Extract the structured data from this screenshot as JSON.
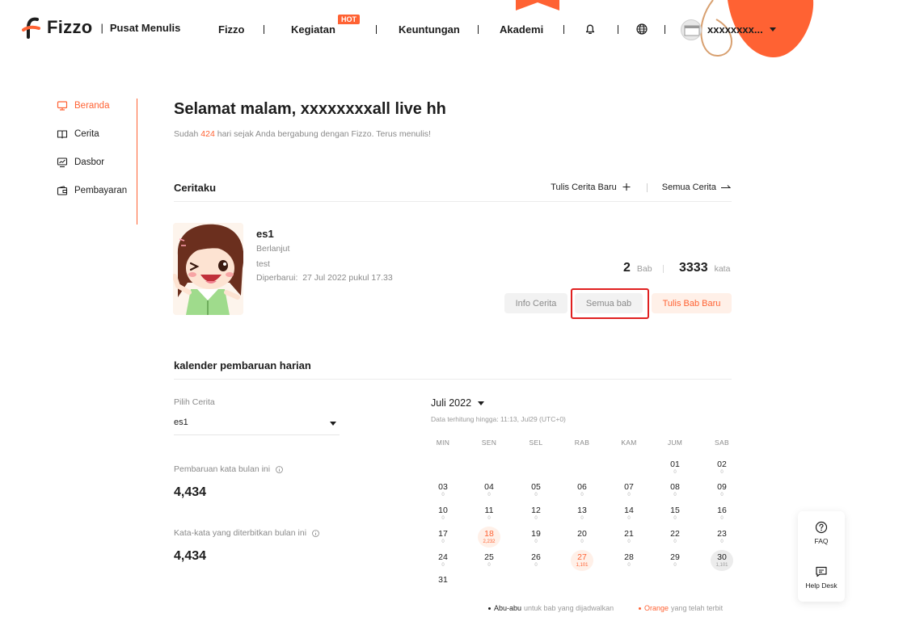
{
  "header": {
    "brand": "Fizzo",
    "sub_brand": "Pusat Menulis",
    "nav": [
      {
        "label": "Fizzo"
      },
      {
        "label": "Kegiatan",
        "badge": "HOT"
      },
      {
        "label": "Keuntungan"
      },
      {
        "label": "Akademi"
      }
    ],
    "username": "xxxxxxxx...",
    "icons": [
      "bell-icon",
      "globe-icon"
    ],
    "accent_color": "#ff6233"
  },
  "sidebar": {
    "items": [
      {
        "label": "Beranda",
        "icon": "monitor-icon",
        "active": true
      },
      {
        "label": "Cerita",
        "icon": "book-icon",
        "active": false
      },
      {
        "label": "Dasbor",
        "icon": "chart-screen-icon",
        "active": false
      },
      {
        "label": "Pembayaran",
        "icon": "wallet-icon",
        "active": false
      }
    ]
  },
  "greeting": {
    "title": "Selamat malam, xxxxxxxxall live hh",
    "prefix": "Sudah",
    "days": "424",
    "suffix": "hari sejak Anda bergabung dengan Fizzo. Terus menulis!"
  },
  "my_stories": {
    "heading": "Ceritaku",
    "new_story": "Tulis Cerita Baru",
    "all_stories": "Semua Cerita",
    "story": {
      "title": "es1",
      "status": "Berlanjut",
      "description": "test",
      "updated_label": "Diperbarui:",
      "updated_value": "27 Jul 2022 pukul 17.33",
      "chapters": "2",
      "chapters_unit": "Bab",
      "words": "3333",
      "words_unit": "kata",
      "btn_info": "Info Cerita",
      "btn_all_chapters": "Semua bab",
      "btn_new_chapter": "Tulis Bab Baru"
    }
  },
  "calendar": {
    "heading": "kalender pembaruan harian",
    "pick_label": "Pilih Cerita",
    "pick_value": "es1",
    "monthly_words_label": "Pembaruan kata bulan ini",
    "monthly_words_value": "4,434",
    "published_words_label": "Kata-kata yang diterbitkan bulan ini",
    "published_words_value": "4,434",
    "month": "Juli 2022",
    "note": "Data terhitung hingga: 11:13, Jul29  (UTC+0)",
    "weekdays": [
      "MIN",
      "SEN",
      "SEL",
      "RAB",
      "KAM",
      "JUM",
      "SAB"
    ],
    "first_weekday_index": 5,
    "days": [
      {
        "day": "01",
        "count": "0"
      },
      {
        "day": "02",
        "count": "0"
      },
      {
        "day": "03",
        "count": "0"
      },
      {
        "day": "04",
        "count": "0"
      },
      {
        "day": "05",
        "count": "0"
      },
      {
        "day": "06",
        "count": "0"
      },
      {
        "day": "07",
        "count": "0"
      },
      {
        "day": "08",
        "count": "0"
      },
      {
        "day": "09",
        "count": "0"
      },
      {
        "day": "10",
        "count": "0"
      },
      {
        "day": "11",
        "count": "0"
      },
      {
        "day": "12",
        "count": "0"
      },
      {
        "day": "13",
        "count": "0"
      },
      {
        "day": "14",
        "count": "0"
      },
      {
        "day": "15",
        "count": "0"
      },
      {
        "day": "16",
        "count": "0"
      },
      {
        "day": "17",
        "count": "0"
      },
      {
        "day": "18",
        "count": "2,232",
        "state": "orange"
      },
      {
        "day": "19",
        "count": "0"
      },
      {
        "day": "20",
        "count": "0"
      },
      {
        "day": "21",
        "count": "0"
      },
      {
        "day": "22",
        "count": "0"
      },
      {
        "day": "23",
        "count": "0"
      },
      {
        "day": "24",
        "count": "0"
      },
      {
        "day": "25",
        "count": "0"
      },
      {
        "day": "26",
        "count": "0"
      },
      {
        "day": "27",
        "count": "1,101",
        "state": "orange"
      },
      {
        "day": "28",
        "count": "0"
      },
      {
        "day": "29",
        "count": "0"
      },
      {
        "day": "30",
        "count": "1,101",
        "state": "gray"
      },
      {
        "day": "31",
        "count": ""
      }
    ],
    "legend_gray_key": "Abu-abu",
    "legend_gray_text": "untuk bab yang dijadwalkan",
    "legend_orange_key": "Orange",
    "legend_orange_text": "yang telah terbit"
  },
  "help": {
    "faq": "FAQ",
    "help_desk": "Help Desk"
  }
}
